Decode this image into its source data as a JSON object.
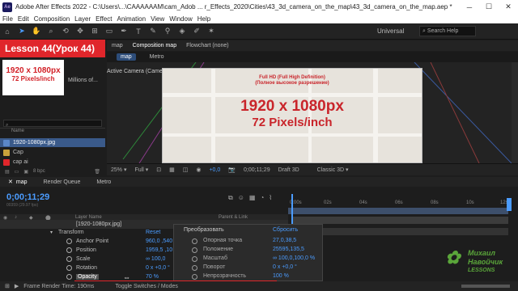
{
  "app": {
    "logo": "Ae",
    "title": "Adobe After Effects 2022 - C:\\Users\\...\\CAAAAAAM\\cam_Adob ... r_Effects_2020\\Cities\\43_3d_camera_on_the_map\\43_3d_camera_on_the_map.aep *"
  },
  "window_buttons": {
    "minimize": "─",
    "maximize": "☐",
    "close": "✕"
  },
  "menu": [
    "File",
    "Edit",
    "Composition",
    "Layer",
    "Effect",
    "Animation",
    "View",
    "Window",
    "Help"
  ],
  "toolbar": {
    "search_placeholder": "Search Help",
    "workspace": "Universal"
  },
  "overlay": {
    "lesson": "Lesson 44(Урок 44)"
  },
  "project": {
    "thumb_line1": "1920 x 1080px",
    "thumb_line2": "72 Pixels/inch",
    "info": "Millions of...",
    "col_name": "Name",
    "items": [
      {
        "name": "1920-1080px.jpg",
        "color": "#5b87c7"
      },
      {
        "name": "Cap",
        "color": "#c9a23b"
      },
      {
        "name": "cap ai",
        "color": "#e0262b"
      }
    ],
    "bpc": "8 bpc"
  },
  "composition": {
    "tab_left": "map",
    "tab_active": "Composition map",
    "tab_flowchart": "Flowchart (none)",
    "subtabs": [
      "map",
      "Metro"
    ],
    "camera_label": "Active Camera (Camera 41)",
    "map_small1": "Full HD (Full High Definition)",
    "map_small2": "(Полное высокое разрешение)",
    "map_big1": "1920 x 1080px",
    "map_big2": "72 Pixels/inch"
  },
  "viewerbar": {
    "zoom": "25%",
    "quality": "Full",
    "exposure": "+0,0",
    "timecode": "0;00;11;29",
    "renderer": "Draft 3D",
    "view": "Classic 3D"
  },
  "timeline": {
    "tabs": [
      "map",
      "Render Queue",
      "Metro"
    ],
    "timecode": "0;00;11;29",
    "fps": "00359 (29.97 fps)",
    "ruler": [
      "0:00s",
      "02s",
      "04s",
      "06s",
      "08s",
      "10s",
      "12s"
    ],
    "header_layer": "Layer Name",
    "header_parent": "Parent & Link",
    "layer_name": "[1920-1080px.jpg]",
    "transform": "Transform",
    "reset": "Reset",
    "props": [
      {
        "name": "Anchor Point",
        "value": "960,0 ,540"
      },
      {
        "name": "Position",
        "value": "1959,5 ,10"
      },
      {
        "name": "Scale",
        "value": "∞ 100,0"
      },
      {
        "name": "Rotation",
        "value": "0 x +0,0 °"
      },
      {
        "name": "Opacity",
        "value": "70 %"
      }
    ]
  },
  "tooltip": {
    "header": "Преобразовать",
    "reset": "Сбросить",
    "rows": [
      {
        "name": "Опорная точка",
        "value": "27,0,38,5"
      },
      {
        "name": "Положение",
        "value": "25595,135,5"
      },
      {
        "name": "Масштаб",
        "value": "∞ 100,0,100,0 %"
      },
      {
        "name": "Поворот",
        "value": "0 x +0,0 °"
      },
      {
        "name": "Непрозрачность",
        "value": "100 %"
      }
    ]
  },
  "bottom": {
    "frame_render": "Frame Render Time: 190ms",
    "toggle": "Toggle Switches / Modes"
  },
  "watermark": {
    "line1": "Михаил",
    "line2": "Навойчик",
    "line3": "LESSONS"
  }
}
